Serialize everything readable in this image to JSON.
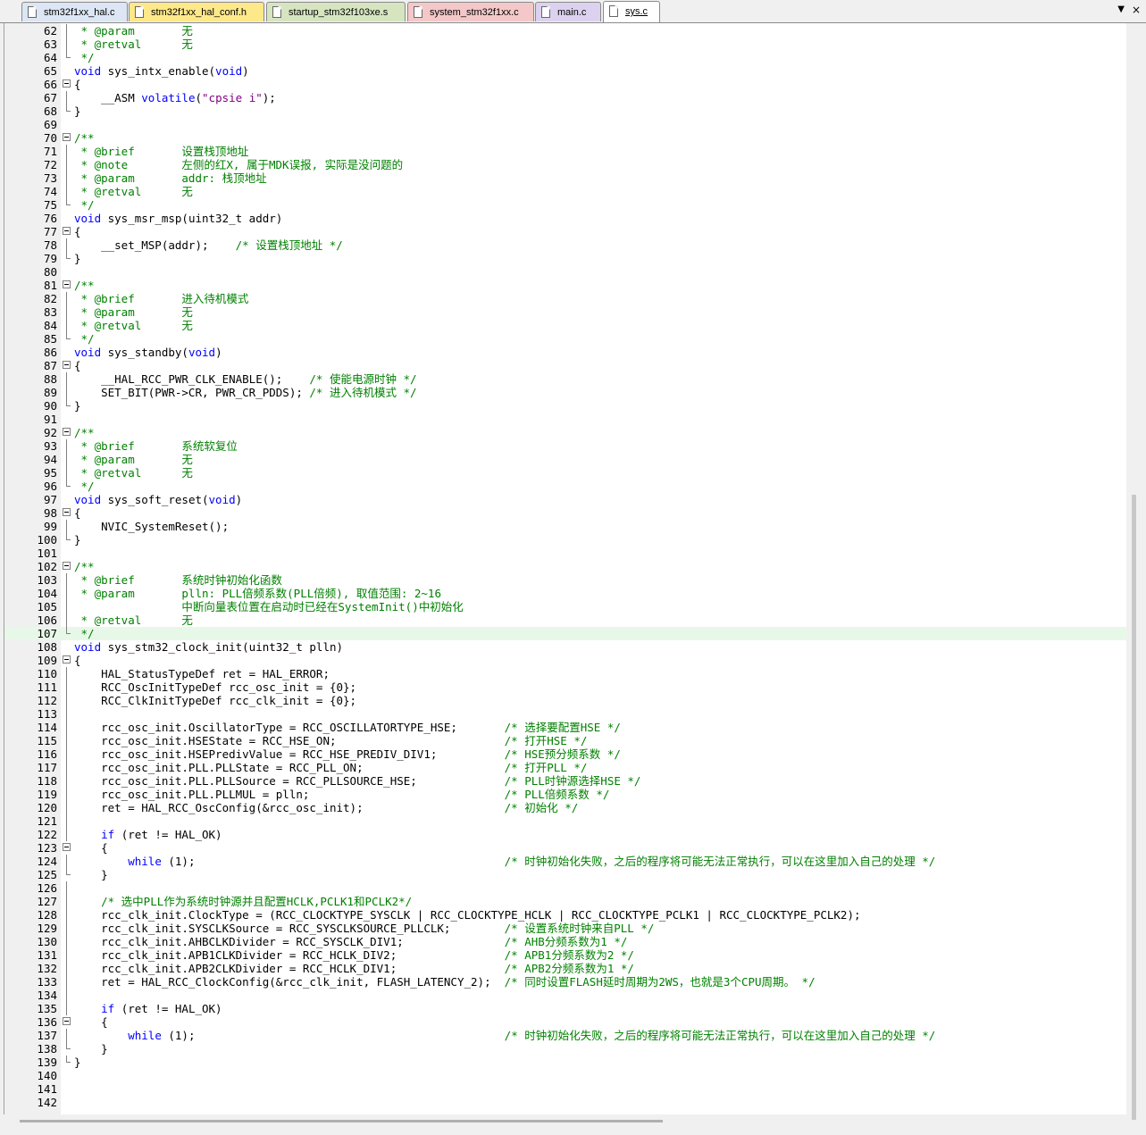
{
  "tabs": [
    {
      "label": "stm32f1xx_hal.c",
      "color": "#dce6f4",
      "active": false
    },
    {
      "label": "stm32f1xx_hal_conf.h",
      "color": "#fde88a",
      "active": false
    },
    {
      "label": "startup_stm32f103xe.s",
      "color": "#d6e5c0",
      "active": false
    },
    {
      "label": "system_stm32f1xx.c",
      "color": "#f4c8c8",
      "active": false
    },
    {
      "label": "main.c",
      "color": "#dcd2ef",
      "active": false
    },
    {
      "label": "sys.c",
      "color": "#ffffff",
      "active": true
    }
  ],
  "highlighted_line": 107,
  "lines": [
    {
      "n": "62",
      "code": " * @param       无",
      "fold": "v"
    },
    {
      "n": "63",
      "code": " * @retval      无",
      "fold": "v"
    },
    {
      "n": "64",
      "code": " */",
      "fold": "e"
    },
    {
      "n": "65",
      "code": "void sys_intx_enable(void)",
      "fold": ""
    },
    {
      "n": "66",
      "code": "{",
      "fold": "b"
    },
    {
      "n": "67",
      "code": "    __ASM volatile(\"cpsie i\");",
      "fold": "v"
    },
    {
      "n": "68",
      "code": "}",
      "fold": "e"
    },
    {
      "n": "69",
      "code": "",
      "fold": ""
    },
    {
      "n": "70",
      "code": "/**",
      "fold": "b"
    },
    {
      "n": "71",
      "code": " * @brief       设置栈顶地址",
      "fold": "v"
    },
    {
      "n": "72",
      "code": " * @note        左侧的红X, 属于MDK误报, 实际是没问题的",
      "fold": "v"
    },
    {
      "n": "73",
      "code": " * @param       addr: 栈顶地址",
      "fold": "v"
    },
    {
      "n": "74",
      "code": " * @retval      无",
      "fold": "v"
    },
    {
      "n": "75",
      "code": " */",
      "fold": "e"
    },
    {
      "n": "76",
      "code": "void sys_msr_msp(uint32_t addr)",
      "fold": ""
    },
    {
      "n": "77",
      "code": "{",
      "fold": "b"
    },
    {
      "n": "78",
      "code": "    __set_MSP(addr);    /* 设置栈顶地址 */",
      "fold": "v"
    },
    {
      "n": "79",
      "code": "}",
      "fold": "e"
    },
    {
      "n": "80",
      "code": "",
      "fold": ""
    },
    {
      "n": "81",
      "code": "/**",
      "fold": "b"
    },
    {
      "n": "82",
      "code": " * @brief       进入待机模式",
      "fold": "v"
    },
    {
      "n": "83",
      "code": " * @param       无",
      "fold": "v"
    },
    {
      "n": "84",
      "code": " * @retval      无",
      "fold": "v"
    },
    {
      "n": "85",
      "code": " */",
      "fold": "e"
    },
    {
      "n": "86",
      "code": "void sys_standby(void)",
      "fold": ""
    },
    {
      "n": "87",
      "code": "{",
      "fold": "b"
    },
    {
      "n": "88",
      "code": "    __HAL_RCC_PWR_CLK_ENABLE();    /* 使能电源时钟 */",
      "fold": "v"
    },
    {
      "n": "89",
      "code": "    SET_BIT(PWR->CR, PWR_CR_PDDS); /* 进入待机模式 */",
      "fold": "v"
    },
    {
      "n": "90",
      "code": "}",
      "fold": "e"
    },
    {
      "n": "91",
      "code": "",
      "fold": ""
    },
    {
      "n": "92",
      "code": "/**",
      "fold": "b"
    },
    {
      "n": "93",
      "code": " * @brief       系统软复位",
      "fold": "v"
    },
    {
      "n": "94",
      "code": " * @param       无",
      "fold": "v"
    },
    {
      "n": "95",
      "code": " * @retval      无",
      "fold": "v"
    },
    {
      "n": "96",
      "code": " */",
      "fold": "e"
    },
    {
      "n": "97",
      "code": "void sys_soft_reset(void)",
      "fold": ""
    },
    {
      "n": "98",
      "code": "{",
      "fold": "b"
    },
    {
      "n": "99",
      "code": "    NVIC_SystemReset();",
      "fold": "v"
    },
    {
      "n": "100",
      "code": "}",
      "fold": "e"
    },
    {
      "n": "101",
      "code": "",
      "fold": ""
    },
    {
      "n": "102",
      "code": "/**",
      "fold": "b"
    },
    {
      "n": "103",
      "code": " * @brief       系统时钟初始化函数",
      "fold": "v"
    },
    {
      "n": "104",
      "code": " * @param       plln: PLL倍频系数(PLL倍频), 取值范围: 2~16",
      "fold": "v"
    },
    {
      "n": "105",
      "code": "                中断向量表位置在启动时已经在SystemInit()中初始化",
      "fold": "v"
    },
    {
      "n": "106",
      "code": " * @retval      无",
      "fold": "v"
    },
    {
      "n": "107",
      "code": " */",
      "fold": "e"
    },
    {
      "n": "108",
      "code": "void sys_stm32_clock_init(uint32_t plln)",
      "fold": ""
    },
    {
      "n": "109",
      "code": "{",
      "fold": "b"
    },
    {
      "n": "110",
      "code": "    HAL_StatusTypeDef ret = HAL_ERROR;",
      "fold": "v"
    },
    {
      "n": "111",
      "code": "    RCC_OscInitTypeDef rcc_osc_init = {0};",
      "fold": "v"
    },
    {
      "n": "112",
      "code": "    RCC_ClkInitTypeDef rcc_clk_init = {0};",
      "fold": "v"
    },
    {
      "n": "113",
      "code": "",
      "fold": "v"
    },
    {
      "n": "114",
      "code": "    rcc_osc_init.OscillatorType = RCC_OSCILLATORTYPE_HSE;       /* 选择要配置HSE */",
      "fold": "v"
    },
    {
      "n": "115",
      "code": "    rcc_osc_init.HSEState = RCC_HSE_ON;                         /* 打开HSE */",
      "fold": "v"
    },
    {
      "n": "116",
      "code": "    rcc_osc_init.HSEPredivValue = RCC_HSE_PREDIV_DIV1;          /* HSE预分频系数 */",
      "fold": "v"
    },
    {
      "n": "117",
      "code": "    rcc_osc_init.PLL.PLLState = RCC_PLL_ON;                     /* 打开PLL */",
      "fold": "v"
    },
    {
      "n": "118",
      "code": "    rcc_osc_init.PLL.PLLSource = RCC_PLLSOURCE_HSE;             /* PLL时钟源选择HSE */",
      "fold": "v"
    },
    {
      "n": "119",
      "code": "    rcc_osc_init.PLL.PLLMUL = plln;                             /* PLL倍频系数 */",
      "fold": "v"
    },
    {
      "n": "120",
      "code": "    ret = HAL_RCC_OscConfig(&rcc_osc_init);                     /* 初始化 */",
      "fold": "v"
    },
    {
      "n": "121",
      "code": "",
      "fold": "v"
    },
    {
      "n": "122",
      "code": "    if (ret != HAL_OK)",
      "fold": "v"
    },
    {
      "n": "123",
      "code": "    {",
      "fold": "b"
    },
    {
      "n": "124",
      "code": "        while (1);                                              /* 时钟初始化失败，之后的程序将可能无法正常执行，可以在这里加入自己的处理 */",
      "fold": "v"
    },
    {
      "n": "125",
      "code": "    }",
      "fold": "e"
    },
    {
      "n": "126",
      "code": "",
      "fold": "v"
    },
    {
      "n": "127",
      "code": "    /* 选中PLL作为系统时钟源并且配置HCLK,PCLK1和PCLK2*/",
      "fold": "v"
    },
    {
      "n": "128",
      "code": "    rcc_clk_init.ClockType = (RCC_CLOCKTYPE_SYSCLK | RCC_CLOCKTYPE_HCLK | RCC_CLOCKTYPE_PCLK1 | RCC_CLOCKTYPE_PCLK2);",
      "fold": "v"
    },
    {
      "n": "129",
      "code": "    rcc_clk_init.SYSCLKSource = RCC_SYSCLKSOURCE_PLLCLK;        /* 设置系统时钟来自PLL */",
      "fold": "v"
    },
    {
      "n": "130",
      "code": "    rcc_clk_init.AHBCLKDivider = RCC_SYSCLK_DIV1;               /* AHB分频系数为1 */",
      "fold": "v"
    },
    {
      "n": "131",
      "code": "    rcc_clk_init.APB1CLKDivider = RCC_HCLK_DIV2;                /* APB1分频系数为2 */",
      "fold": "v"
    },
    {
      "n": "132",
      "code": "    rcc_clk_init.APB2CLKDivider = RCC_HCLK_DIV1;                /* APB2分频系数为1 */",
      "fold": "v"
    },
    {
      "n": "133",
      "code": "    ret = HAL_RCC_ClockConfig(&rcc_clk_init, FLASH_LATENCY_2);  /* 同时设置FLASH延时周期为2WS，也就是3个CPU周期。 */",
      "fold": "v"
    },
    {
      "n": "134",
      "code": "",
      "fold": "v"
    },
    {
      "n": "135",
      "code": "    if (ret != HAL_OK)",
      "fold": "v"
    },
    {
      "n": "136",
      "code": "    {",
      "fold": "b"
    },
    {
      "n": "137",
      "code": "        while (1);                                              /* 时钟初始化失败，之后的程序将可能无法正常执行，可以在这里加入自己的处理 */",
      "fold": "v"
    },
    {
      "n": "138",
      "code": "    }",
      "fold": "e"
    },
    {
      "n": "139",
      "code": "}",
      "fold": "e"
    },
    {
      "n": "140",
      "code": "",
      "fold": ""
    },
    {
      "n": "141",
      "code": "",
      "fold": ""
    },
    {
      "n": "142",
      "code": "",
      "fold": ""
    }
  ]
}
